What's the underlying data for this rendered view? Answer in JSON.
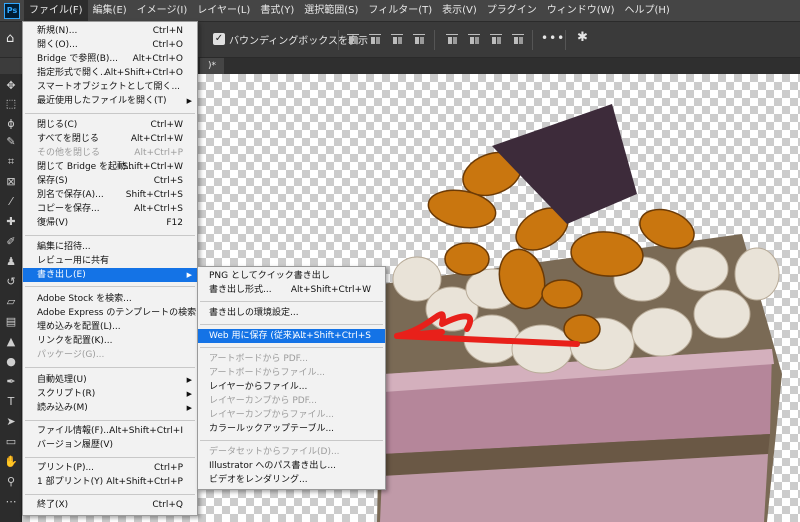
{
  "menubar": {
    "logo": "Ps",
    "items": [
      "ファイル(F)",
      "編集(E)",
      "イメージ(I)",
      "レイヤー(L)",
      "書式(Y)",
      "選択範囲(S)",
      "フィルター(T)",
      "表示(V)",
      "プラグイン",
      "ウィンドウ(W)",
      "ヘルプ(H)"
    ]
  },
  "options": {
    "bounding_box_label": "バウンディングボックスを表示",
    "bounding_box_checked": true,
    "more": "•••"
  },
  "document_tab": {
    "label": ")*"
  },
  "file_menu": {
    "items": [
      {
        "label": "新規(N)...",
        "shortcut": "Ctrl+N"
      },
      {
        "label": "開く(O)...",
        "shortcut": "Ctrl+O"
      },
      {
        "label": "Bridge で参照(B)...",
        "shortcut": "Alt+Ctrl+O"
      },
      {
        "label": "指定形式で開く...",
        "shortcut": "Alt+Shift+Ctrl+O"
      },
      {
        "label": "スマートオブジェクトとして開く...",
        "shortcut": ""
      },
      {
        "label": "最近使用したファイルを開く(T)",
        "shortcut": ""
      },
      {
        "label": "閉じる(C)",
        "shortcut": "Ctrl+W"
      },
      {
        "label": "すべてを閉じる",
        "shortcut": "Alt+Ctrl+W"
      },
      {
        "label": "その他を閉じる",
        "shortcut": "Alt+Ctrl+P"
      },
      {
        "label": "閉じて Bridge を起動...",
        "shortcut": "Shift+Ctrl+W"
      },
      {
        "label": "保存(S)",
        "shortcut": "Ctrl+S"
      },
      {
        "label": "別名で保存(A)...",
        "shortcut": "Shift+Ctrl+S"
      },
      {
        "label": "コピーを保存...",
        "shortcut": "Alt+Ctrl+S"
      },
      {
        "label": "復帰(V)",
        "shortcut": "F12"
      },
      {
        "label": "編集に招待...",
        "shortcut": ""
      },
      {
        "label": "レビュー用に共有",
        "shortcut": ""
      },
      {
        "label": "書き出し(E)",
        "shortcut": ""
      },
      {
        "label": "Adobe Stock を検索...",
        "shortcut": ""
      },
      {
        "label": "Adobe Express のテンプレートの検索...",
        "shortcut": ""
      },
      {
        "label": "埋め込みを配置(L)...",
        "shortcut": ""
      },
      {
        "label": "リンクを配置(K)...",
        "shortcut": ""
      },
      {
        "label": "パッケージ(G)...",
        "shortcut": ""
      },
      {
        "label": "自動処理(U)",
        "shortcut": ""
      },
      {
        "label": "スクリプト(R)",
        "shortcut": ""
      },
      {
        "label": "読み込み(M)",
        "shortcut": ""
      },
      {
        "label": "ファイル情報(F)...",
        "shortcut": "Alt+Shift+Ctrl+I"
      },
      {
        "label": "バージョン履歴(V)",
        "shortcut": ""
      },
      {
        "label": "プリント(P)...",
        "shortcut": "Ctrl+P"
      },
      {
        "label": "1 部プリント(Y)",
        "shortcut": "Alt+Shift+Ctrl+P"
      },
      {
        "label": "終了(X)",
        "shortcut": "Ctrl+Q"
      }
    ]
  },
  "export_menu": {
    "items": [
      {
        "label": "PNG としてクイック書き出し",
        "shortcut": ""
      },
      {
        "label": "書き出し形式...",
        "shortcut": "Alt+Shift+Ctrl+W"
      },
      {
        "label": "書き出しの環境設定...",
        "shortcut": ""
      },
      {
        "label": "Web 用に保存 (従来)...",
        "shortcut": "Alt+Shift+Ctrl+S"
      },
      {
        "label": "アートボードから PDF...",
        "shortcut": ""
      },
      {
        "label": "アートボードからファイル...",
        "shortcut": ""
      },
      {
        "label": "レイヤーからファイル...",
        "shortcut": ""
      },
      {
        "label": "レイヤーカンプから PDF...",
        "shortcut": ""
      },
      {
        "label": "レイヤーカンプからファイル...",
        "shortcut": ""
      },
      {
        "label": "カラールックアップテーブル...",
        "shortcut": ""
      },
      {
        "label": "データセットからファイル(D)...",
        "shortcut": ""
      },
      {
        "label": "Illustrator へのパス書き出し...",
        "shortcut": ""
      },
      {
        "label": "ビデオをレンダリング...",
        "shortcut": ""
      }
    ]
  },
  "colors": {
    "highlight": "#1473e6",
    "annotation_arrow": "#e8201a"
  }
}
